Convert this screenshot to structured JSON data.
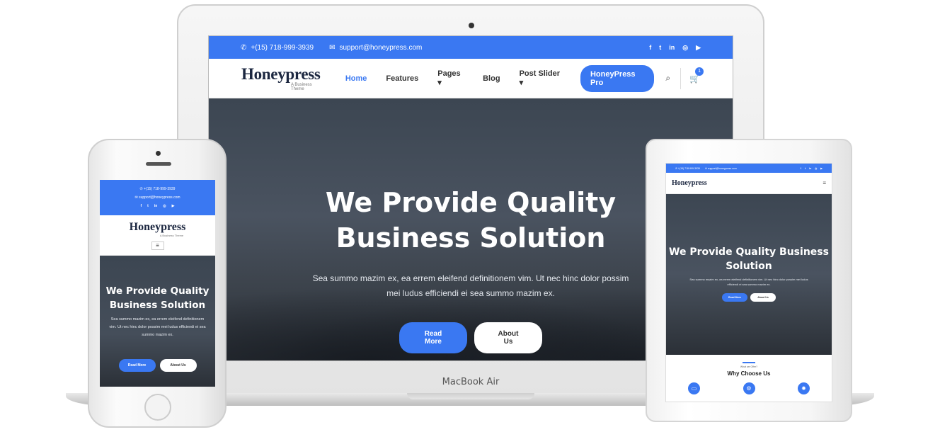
{
  "colors": {
    "accent": "#3a78f2",
    "hero_dark": "#3c4652",
    "logo_navy": "#1c2740"
  },
  "laptop": {
    "brand_label": "MacBook Air",
    "topbar": {
      "phone_icon": "phone-icon",
      "phone": "+(15) 718-999-3939",
      "email_icon": "envelope-icon",
      "email": "support@honeypress.com",
      "socials": [
        "f",
        "t",
        "in",
        "◎",
        "▶"
      ]
    },
    "nav": {
      "logo": "Honeypress",
      "tagline": "A Business Theme",
      "items": [
        "Home",
        "Features",
        "Pages ▾",
        "Blog",
        "Post Slider ▾"
      ],
      "pro_button": "HoneyPress Pro",
      "search_icon": "⌕",
      "cart_icon": "🛒",
      "cart_count": "1"
    },
    "hero": {
      "title": "We Provide Quality Business Solution",
      "text": "Sea summo mazim ex, ea errem eleifend definitionem vim. Ut nec hinc dolor possim mei ludus efficiendi ei sea summo mazim ex.",
      "primary_button": "Read More",
      "secondary_button": "About Us"
    }
  },
  "phone": {
    "topbar": {
      "phone": "+(15) 718-999-3939",
      "email": "support@honeypress.com",
      "socials": [
        "f",
        "t",
        "in",
        "◎",
        "▶"
      ]
    },
    "logo": "Honeypress",
    "tagline": "A Business Theme",
    "menu_icon": "≡",
    "hero": {
      "title": "We Provide Quality Business Solution",
      "text": "Sea summo mazim ex, ea errem eleifend definitionem vim. Ut nec hinc dolor possim mei ludus efficiendi ei sea summo mazim ex.",
      "primary_button": "Read More",
      "secondary_button": "About Us"
    }
  },
  "tablet": {
    "topbar": {
      "phone": "+(15) 718-999-3939",
      "email": "support@honeypress.com",
      "socials": [
        "f",
        "t",
        "in",
        "◎",
        "▶"
      ]
    },
    "logo": "Honeypress",
    "menu_icon": "≡",
    "hero": {
      "title": "We Provide Quality Business Solution",
      "text": "Sea summo mazim ex, ea errem eleifend definitionem vim. Ut nec hinc dolor possim mei ludus efficiendi ei sea summo mazim ex.",
      "primary_button": "Read More",
      "secondary_button": "About Us"
    },
    "section": {
      "kicker": "What we Offer?",
      "heading": "Why Choose Us",
      "icons": [
        "▭",
        "⚙",
        "✹"
      ]
    }
  }
}
